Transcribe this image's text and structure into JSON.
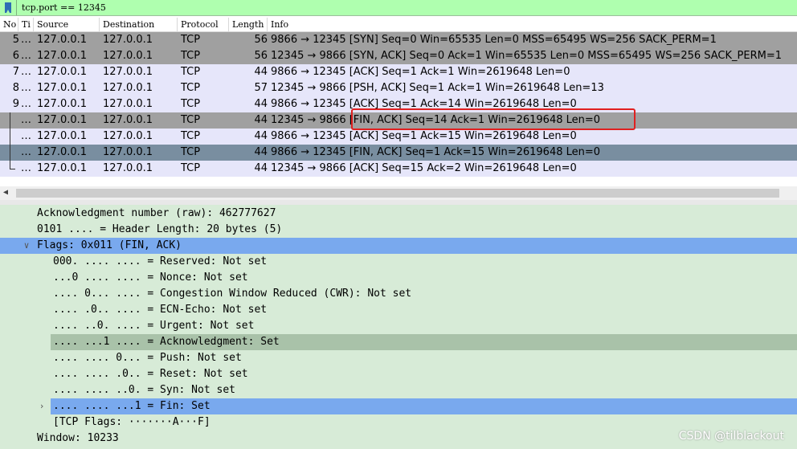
{
  "filter": {
    "value": "tcp.port == 12345"
  },
  "columns": [
    "No",
    "Ti",
    "Source",
    "Destination",
    "Protocol",
    "Length",
    "Info"
  ],
  "packets": [
    {
      "no": "5",
      "time": "…",
      "src": "127.0.0.1",
      "dst": "127.0.0.1",
      "proto": "TCP",
      "len": "56",
      "info": "9866 → 12345 [SYN] Seq=0 Win=65535 Len=0 MSS=65495 WS=256 SACK_PERM=1"
    },
    {
      "no": "6",
      "time": "…",
      "src": "127.0.0.1",
      "dst": "127.0.0.1",
      "proto": "TCP",
      "len": "56",
      "info": "12345 → 9866 [SYN, ACK] Seq=0 Ack=1 Win=65535 Len=0 MSS=65495 WS=256 SACK_PERM=1"
    },
    {
      "no": "7",
      "time": "…",
      "src": "127.0.0.1",
      "dst": "127.0.0.1",
      "proto": "TCP",
      "len": "44",
      "info": "9866 → 12345 [ACK] Seq=1 Ack=1 Win=2619648 Len=0"
    },
    {
      "no": "8",
      "time": "…",
      "src": "127.0.0.1",
      "dst": "127.0.0.1",
      "proto": "TCP",
      "len": "57",
      "info": "12345 → 9866 [PSH, ACK] Seq=1 Ack=1 Win=2619648 Len=13"
    },
    {
      "no": "9",
      "time": "…",
      "src": "127.0.0.1",
      "dst": "127.0.0.1",
      "proto": "TCP",
      "len": "44",
      "info": "9866 → 12345 [ACK] Seq=1 Ack=14 Win=2619648 Len=0"
    },
    {
      "no": "",
      "time": "…",
      "src": "127.0.0.1",
      "dst": "127.0.0.1",
      "proto": "TCP",
      "len": "44",
      "info": "12345 → 9866 [FIN, ACK] Seq=14 Ack=1 Win=2619648 Len=0"
    },
    {
      "no": "",
      "time": "…",
      "src": "127.0.0.1",
      "dst": "127.0.0.1",
      "proto": "TCP",
      "len": "44",
      "info": "9866 → 12345 [ACK] Seq=1 Ack=15 Win=2619648 Len=0"
    },
    {
      "no": "",
      "time": "…",
      "src": "127.0.0.1",
      "dst": "127.0.0.1",
      "proto": "TCP",
      "len": "44",
      "info": "9866 → 12345 [FIN, ACK] Seq=1 Ack=15 Win=2619648 Len=0"
    },
    {
      "no": "",
      "time": "…",
      "src": "127.0.0.1",
      "dst": "127.0.0.1",
      "proto": "TCP",
      "len": "44",
      "info": "12345 → 9866 [ACK] Seq=15 Ack=2 Win=2619648 Len=0"
    }
  ],
  "details": [
    {
      "text": "Acknowledgment number (raw): 462777627"
    },
    {
      "text": "0101 .... = Header Length: 20 bytes (5)"
    },
    {
      "text": "Flags: 0x011 (FIN, ACK)"
    },
    {
      "text": "000. .... .... = Reserved: Not set"
    },
    {
      "text": "...0 .... .... = Nonce: Not set"
    },
    {
      "text": ".... 0... .... = Congestion Window Reduced (CWR): Not set"
    },
    {
      "text": ".... .0.. .... = ECN-Echo: Not set"
    },
    {
      "text": ".... ..0. .... = Urgent: Not set"
    },
    {
      "text": ".... ...1 .... = Acknowledgment: Set"
    },
    {
      "text": ".... .... 0... = Push: Not set"
    },
    {
      "text": ".... .... .0.. = Reset: Not set"
    },
    {
      "text": ".... .... ..0. = Syn: Not set"
    },
    {
      "text": ".... .... ...1 = Fin: Set"
    },
    {
      "text": "[TCP Flags: ·······A···F]"
    },
    {
      "text": "Window: 10233"
    }
  ],
  "colors": {
    "filter_ok": "#afffaf",
    "row_grey": "#a0a0a0",
    "row_lavender": "#e6e6fa",
    "row_selected": "#798ea0",
    "details_bg": "#d7ebd7",
    "highlight": "#79a9ee",
    "annotation": "#e02020"
  },
  "watermark": "CSDN @tilblackout"
}
